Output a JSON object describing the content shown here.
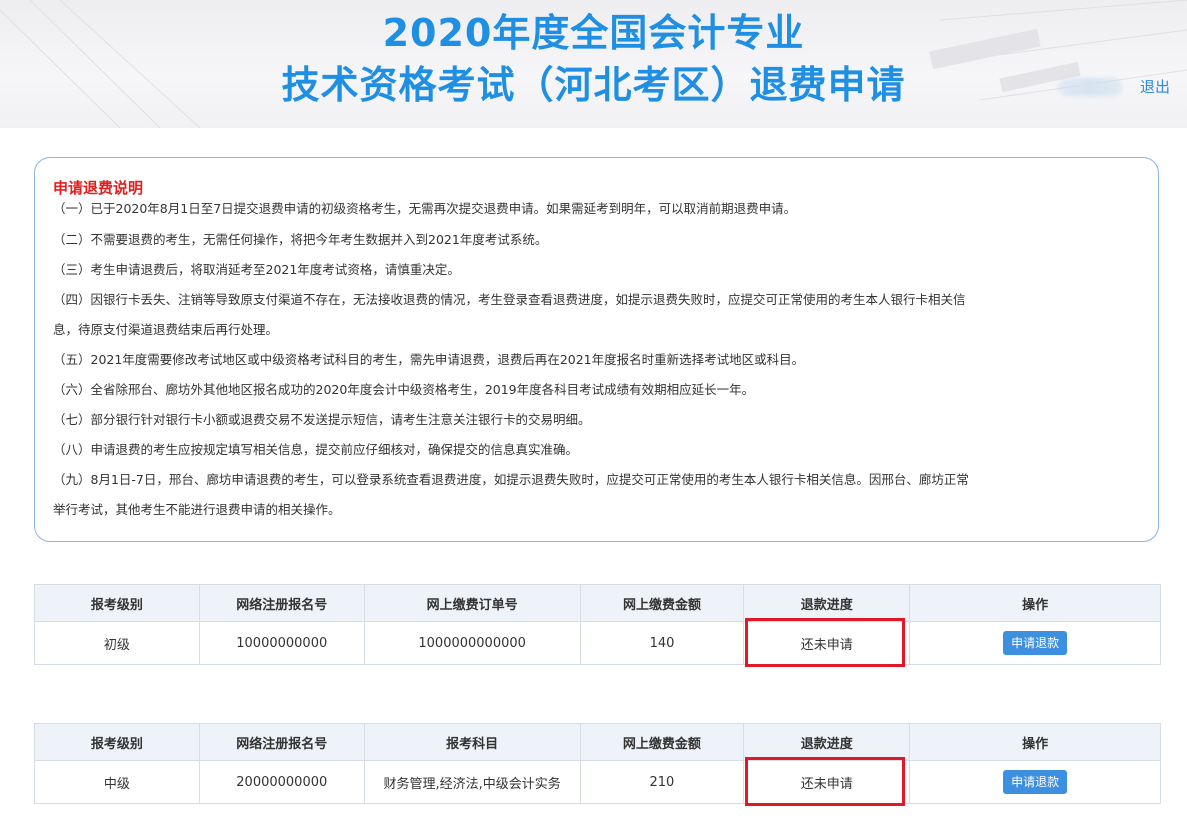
{
  "header": {
    "title_line1": "2020年度全国会计专业",
    "title_line2": "技术资格考试（河北考区）退费申请",
    "logout_label": "退出"
  },
  "notice": {
    "title": "申请退费说明",
    "items": [
      "（一）已于2020年8月1日至7日提交退费申请的初级资格考生，无需再次提交退费申请。如果需延考到明年，可以取消前期退费申请。",
      "（二）不需要退费的考生，无需任何操作，将把今年考生数据并入到2021年度考试系统。",
      "（三）考生申请退费后，将取消延考至2021年度考试资格，请慎重决定。",
      "（四）因银行卡丢失、注销等导致原支付渠道不存在，无法接收退费的情况，考生登录查看退费进度，如提示退费失败时，应提交可正常使用的考生本人银行卡相关信",
      "息，待原支付渠道退费结束后再行处理。",
      "（五）2021年度需要修改考试地区或中级资格考试科目的考生，需先申请退费，退费后再在2021年度报名时重新选择考试地区或科目。",
      "（六）全省除邢台、廊坊外其他地区报名成功的2020年度会计中级资格考生，2019年度各科目考试成绩有效期相应延长一年。",
      "（七）部分银行针对银行卡小额或退费交易不发送提示短信，请考生注意关注银行卡的交易明细。",
      "（八）申请退费的考生应按规定填写相关信息，提交前应仔细核对，确保提交的信息真实准确。",
      "（九）8月1日-7日，邢台、廊坊申请退费的考生，可以登录系统查看退费进度，如提示退费失败时，应提交可正常使用的考生本人银行卡相关信息。因邢台、廊坊正常",
      "举行考试，其他考生不能进行退费申请的相关操作。"
    ]
  },
  "table1": {
    "headers": [
      "报考级别",
      "网络注册报名号",
      "网上缴费订单号",
      "网上缴费金额",
      "退款进度",
      "操作"
    ],
    "row": {
      "level": "初级",
      "reg_no": "10000000000",
      "order_no": "1000000000000",
      "amount": "140",
      "status": "还未申请",
      "action": "申请退款"
    }
  },
  "table2": {
    "headers": [
      "报考级别",
      "网络注册报名号",
      "报考科目",
      "网上缴费金额",
      "退款进度",
      "操作"
    ],
    "row": {
      "level": "中级",
      "reg_no": "20000000000",
      "subjects": "财务管理,经济法,中级会计实务",
      "amount": "210",
      "status": "还未申请",
      "action": "申请退款"
    }
  },
  "colors": {
    "title_blue": "#1f8fe3",
    "notice_title_red": "#e02020",
    "highlight_red": "#e0182a",
    "button_blue": "#3d8fe0"
  }
}
